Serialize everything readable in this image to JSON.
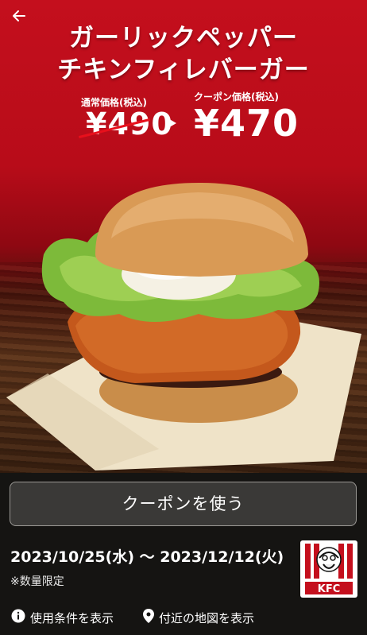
{
  "header": {
    "back_icon": "arrow-left-icon",
    "title_line1": "ガーリックペッパー",
    "title_line2": "チキンフィレバーガー"
  },
  "prices": {
    "regular_label": "通常価格(税込)",
    "regular_price": "¥490",
    "coupon_label": "クーポン価格(税込)",
    "coupon_price": "¥470"
  },
  "coupon_button": {
    "label": "クーポンを使う"
  },
  "validity": {
    "period": "2023/10/25(水) 〜 2023/12/12(火)",
    "note": "※数量限定"
  },
  "brand": {
    "logo_text": "KFC",
    "accent_color": "#c40f1d"
  },
  "footer": {
    "terms": {
      "icon": "info-icon",
      "label": "使用条件を表示"
    },
    "map": {
      "icon": "location-pin-icon",
      "label": "付近の地図を表示"
    }
  }
}
